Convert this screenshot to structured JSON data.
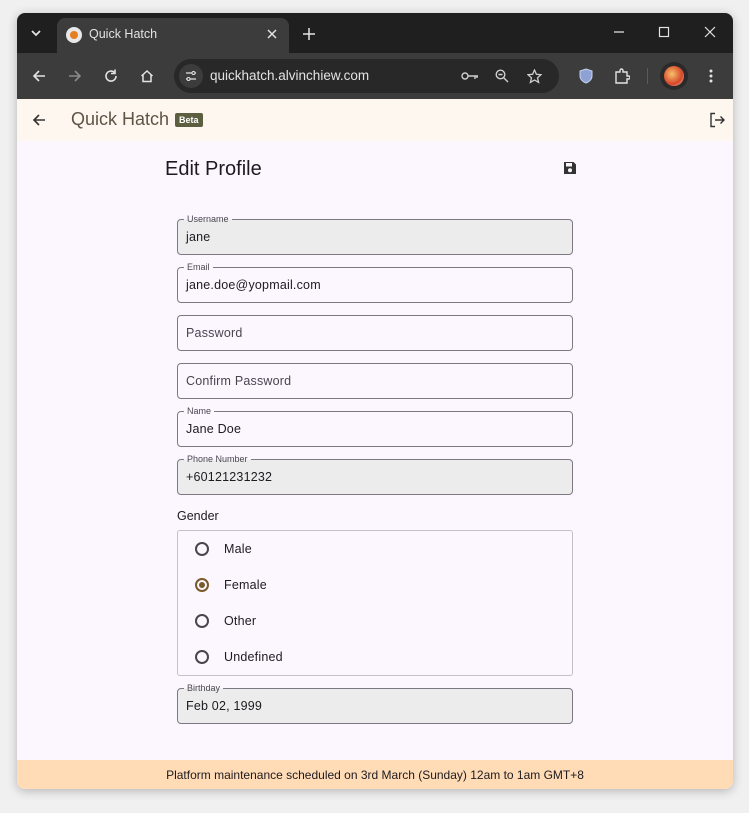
{
  "browser": {
    "tab_title": "Quick Hatch",
    "url": "quickhatch.alvinchiew.com"
  },
  "app": {
    "title": "Quick Hatch",
    "badge": "Beta"
  },
  "page": {
    "heading": "Edit Profile"
  },
  "form": {
    "username": {
      "label": "Username",
      "value": "jane"
    },
    "email": {
      "label": "Email",
      "value": "jane.doe@yopmail.com"
    },
    "password": {
      "placeholder": "Password"
    },
    "confirm_password": {
      "placeholder": "Confirm Password"
    },
    "name": {
      "label": "Name",
      "value": "Jane Doe"
    },
    "phone": {
      "label": "Phone Number",
      "value": "+60121231232"
    },
    "gender": {
      "label": "Gender",
      "options": [
        "Male",
        "Female",
        "Other",
        "Undefined"
      ],
      "selected": "Female"
    },
    "birthday": {
      "label": "Birthday",
      "value": "Feb 02, 1999"
    }
  },
  "banner": {
    "text": "Platform maintenance scheduled on 3rd March (Sunday) 12am to 1am GMT+8"
  },
  "colors": {
    "accent": "#7a5a2a",
    "banner_bg": "#ffdbb6",
    "badge_bg": "#5c5f3f"
  }
}
